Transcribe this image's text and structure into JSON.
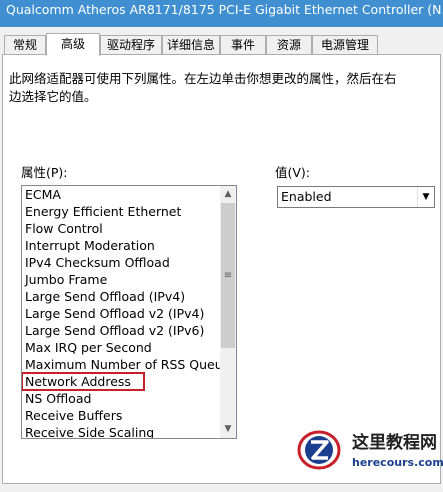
{
  "window": {
    "title": "Qualcomm Atheros AR8171/8175 PCI-E Gigabit Ethernet Controller (N..."
  },
  "tabs": [
    {
      "label": "常规",
      "active": false
    },
    {
      "label": "高级",
      "active": true
    },
    {
      "label": "驱动程序",
      "active": false
    },
    {
      "label": "详细信息",
      "active": false
    },
    {
      "label": "事件",
      "active": false
    },
    {
      "label": "资源",
      "active": false
    },
    {
      "label": "电源管理",
      "active": false
    }
  ],
  "advanced": {
    "description_line1": "此网络适配器可使用下列属性。在左边单击你想更改的属性，然后在右",
    "description_line2": "边选择它的值。",
    "property_label": "属性(P):",
    "value_label": "值(V):",
    "properties": [
      "ECMA",
      "Energy Efficient Ethernet",
      "Flow Control",
      "Interrupt Moderation",
      "IPv4 Checksum Offload",
      "Jumbo Frame",
      "Large Send Offload (IPv4)",
      "Large Send Offload v2 (IPv4)",
      "Large Send Offload v2 (IPv6)",
      "Max IRQ per Second",
      "Maximum Number of RSS Queue",
      "Network Address",
      "NS Offload",
      "Receive Buffers",
      "Receive Side Scaling"
    ],
    "highlighted_property": "Network Address",
    "value_selected": "Enabled",
    "highlight_color": "#c8202a"
  },
  "watermark": {
    "title": "这里教程网",
    "url": "herecours.com"
  }
}
